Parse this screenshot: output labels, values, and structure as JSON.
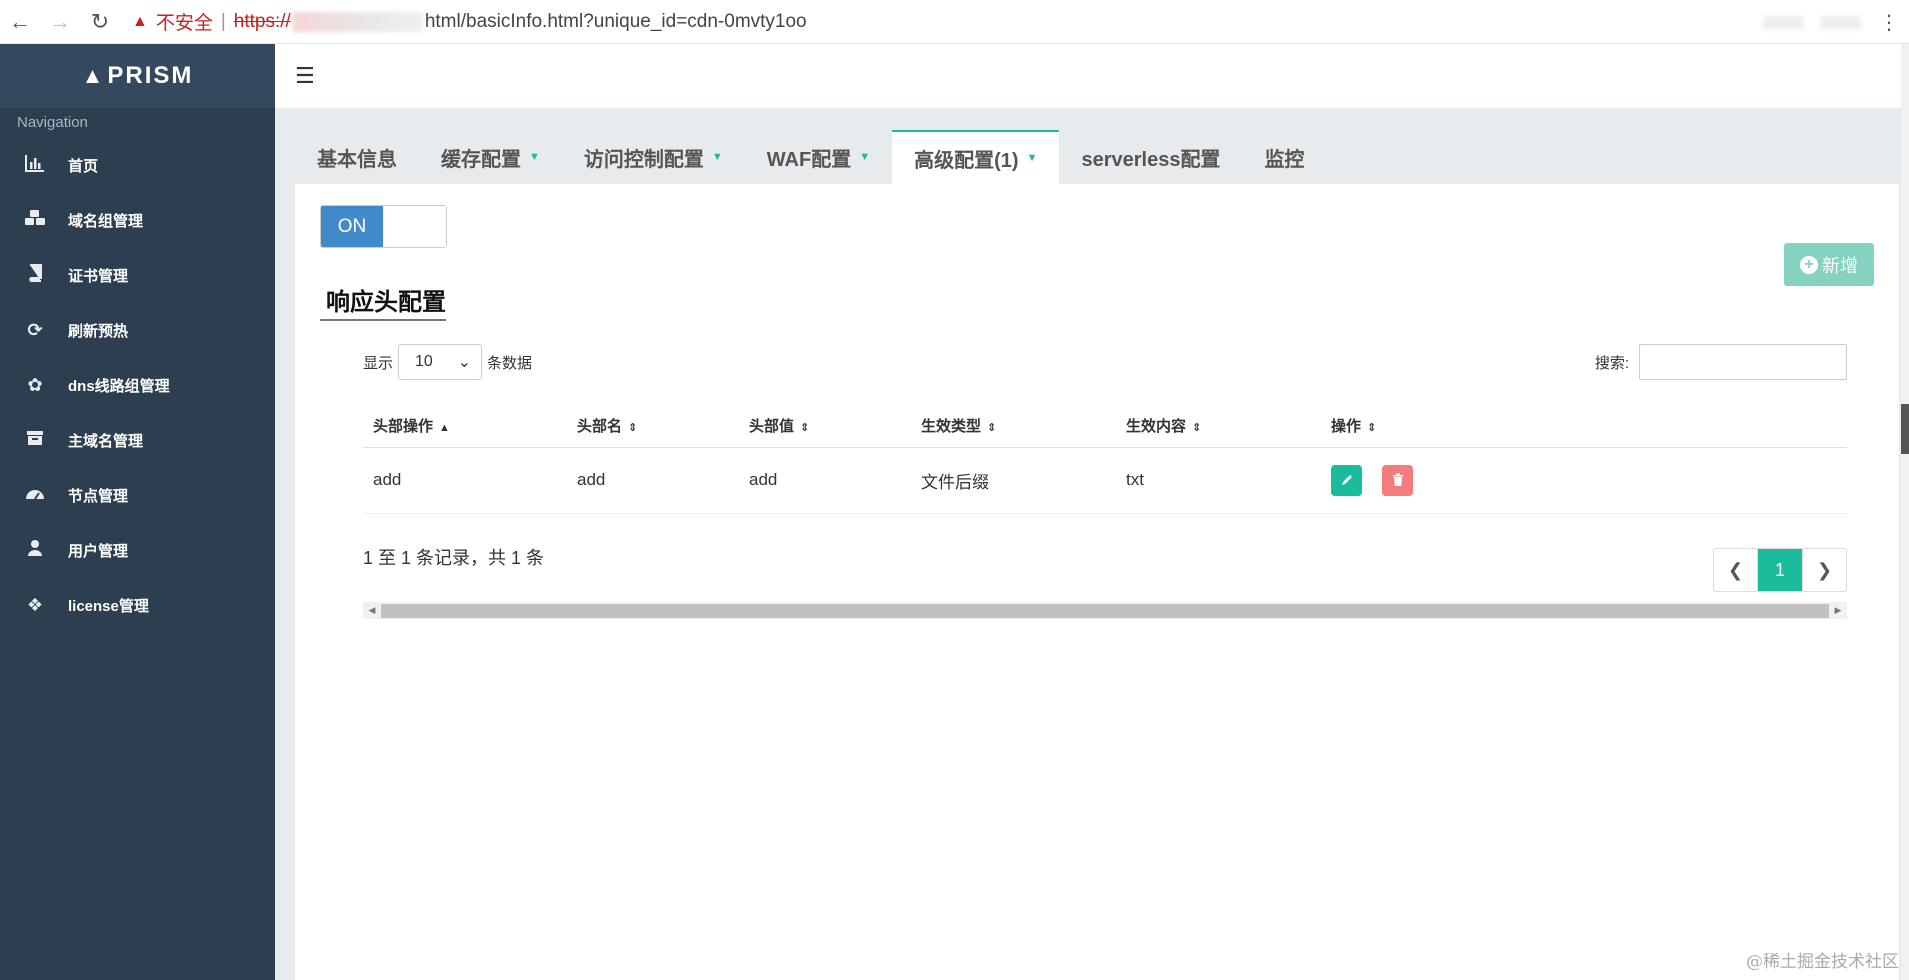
{
  "browser": {
    "insecure_label": "不安全",
    "url_scheme": "https://",
    "url_rest": "html/basicInfo.html?unique_id=cdn-0mvty1oo"
  },
  "sidebar": {
    "logo": "PRISM",
    "nav_title": "Navigation",
    "items": [
      {
        "label": "首页",
        "icon": "bar-chart-icon"
      },
      {
        "label": "域名组管理",
        "icon": "cubes-icon"
      },
      {
        "label": "证书管理",
        "icon": "book-icon"
      },
      {
        "label": "刷新预热",
        "icon": "refresh-icon"
      },
      {
        "label": "dns线路组管理",
        "icon": "pagelines-icon"
      },
      {
        "label": "主域名管理",
        "icon": "archive-icon"
      },
      {
        "label": "节点管理",
        "icon": "dashboard-icon"
      },
      {
        "label": "用户管理",
        "icon": "user-icon"
      },
      {
        "label": "license管理",
        "icon": "dropbox-icon"
      }
    ]
  },
  "tabs": [
    {
      "label": "基本信息",
      "dropdown": false
    },
    {
      "label": "缓存配置",
      "dropdown": true
    },
    {
      "label": "访问控制配置",
      "dropdown": true
    },
    {
      "label": "WAF配置",
      "dropdown": true
    },
    {
      "label": "高级配置(1)",
      "dropdown": true,
      "active": true
    },
    {
      "label": "serverless配置",
      "dropdown": false
    },
    {
      "label": "监控",
      "dropdown": false
    }
  ],
  "toggle": {
    "on_label": "ON"
  },
  "add_button": {
    "label": "新增"
  },
  "section_title": "响应头配置",
  "length": {
    "prefix": "显示",
    "value": "10",
    "suffix": "条数据"
  },
  "search": {
    "label": "搜索:",
    "value": ""
  },
  "table": {
    "columns": [
      "头部操作",
      "头部名",
      "头部值",
      "生效类型",
      "生效内容",
      "操作"
    ],
    "rows": [
      {
        "op": "add",
        "name": "add",
        "value": "add",
        "type": "文件后缀",
        "content": "txt"
      }
    ]
  },
  "info_text": "1 至 1 条记录，共 1 条",
  "pager": {
    "current": "1"
  },
  "watermark": "@稀土掘金技术社区",
  "colors": {
    "sidebar": "#2c3e50",
    "accent": "#1abc9c",
    "toggle_on": "#428bca",
    "delete": "#f47c7c"
  }
}
